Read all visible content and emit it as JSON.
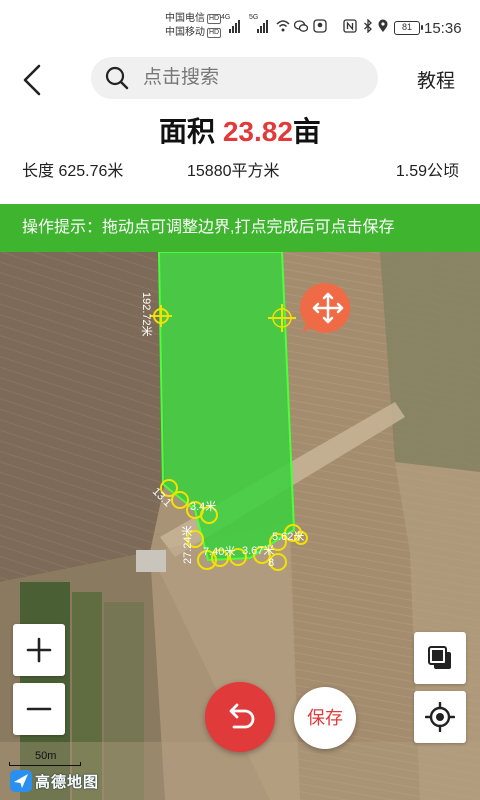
{
  "status_bar": {
    "carrier1": "中国电信",
    "carrier2": "中国移动",
    "hd": "HD",
    "net1": "4G",
    "net2": "5G",
    "battery": "81",
    "time": "15:36"
  },
  "header": {
    "search_placeholder": "点击搜索",
    "tutorial": "教程"
  },
  "area": {
    "label": "面积",
    "value": "23.82",
    "unit": "亩"
  },
  "stats": {
    "length": "长度 625.76米",
    "square_meters": "15880平方米",
    "hectares": "1.59公顷"
  },
  "tip": "操作提示：拖动点可调整边界,打点完成后可点击保存",
  "map": {
    "edge_labels": [
      "192.72米",
      "13.1",
      "3.4米",
      "27.24米",
      "7.40米",
      "3.67米",
      "8",
      "5.62米"
    ],
    "scale_label": "50m",
    "logo_text": "高德地图"
  },
  "buttons": {
    "save": "保存"
  },
  "colors": {
    "accent_red": "#e13a3a",
    "tip_green": "#3fb52f",
    "polygon_fill": "#33d33a"
  }
}
